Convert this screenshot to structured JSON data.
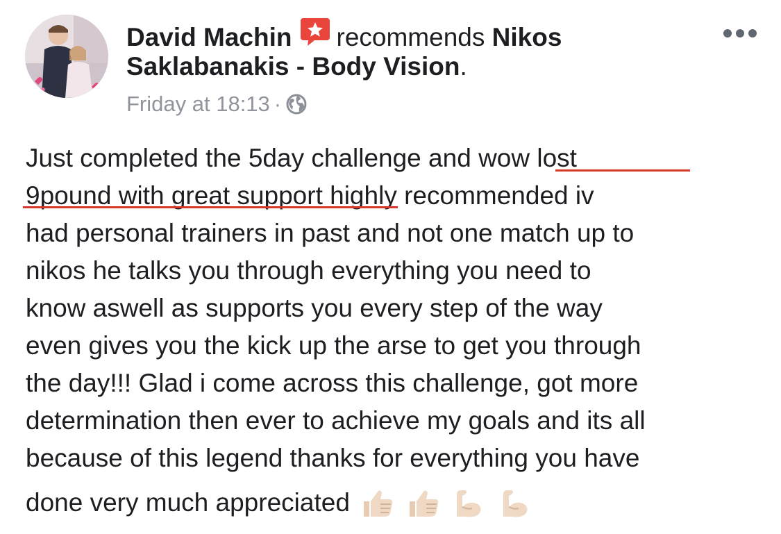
{
  "post": {
    "author": "David Machin",
    "action": "recommends",
    "page_name_part1": "Nikos",
    "page_name_part2": "Saklabanakis - Body Vision",
    "period": ".",
    "timestamp": "Friday at 18:13",
    "separator": "·",
    "privacy_icon": "globe-icon",
    "recommend_icon": "recommend-star-icon",
    "more_icon": "more-options-icon",
    "body_lines": [
      "Just completed the 5day challenge and ",
      "wow lost",
      "9pound  with great support",
      " highly recommended iv",
      "had personal trainers in past and not one match up to",
      "nikos he talks you through everything you need to",
      "know aswell as supports you every step of the way",
      "even gives you the kick up the arse to get you through",
      "the day!!! Glad i come across this challenge, got more",
      "determination then ever to achieve my goals and its all",
      "because of this legend thanks for everything you have",
      "done very much appreciated"
    ],
    "emojis": [
      "thumbs-up-emoji",
      "thumbs-up-emoji",
      "flexed-biceps-emoji",
      "flexed-biceps-emoji"
    ]
  },
  "colors": {
    "text": "#1c1e21",
    "meta": "#90949c",
    "badge": "#e9453b",
    "annotation_underline": "#d9372b"
  }
}
